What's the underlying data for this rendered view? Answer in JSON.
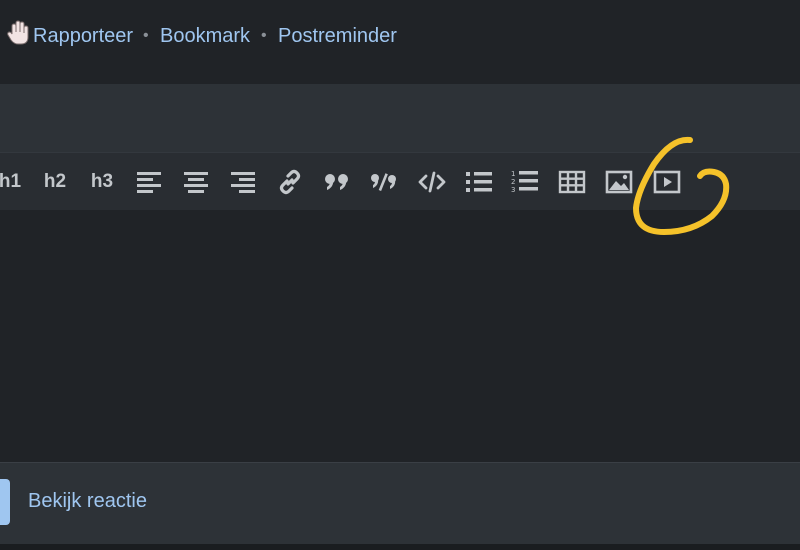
{
  "post_actions": {
    "report_label": "Rapporteer",
    "bookmark_label": "Bookmark",
    "reminder_label": "Postreminder",
    "separator": "•",
    "report_icon": "hand-icon"
  },
  "toolbar": {
    "h1_label": "h1",
    "h2_label": "h2",
    "h3_label": "h3",
    "buttons": [
      "align-left-icon",
      "align-center-icon",
      "align-right-icon",
      "link-icon",
      "quote-icon",
      "spoiler-icon",
      "code-icon",
      "bulleted-list-icon",
      "numbered-list-icon",
      "table-icon",
      "image-icon",
      "video-icon"
    ]
  },
  "footer": {
    "view_reply_label": "Bekijk reactie"
  },
  "colors": {
    "link": "#9fc6f0",
    "icon": "#c3c7cb",
    "background": "#202327",
    "panel": "#2d3237",
    "annotation": "#f5c22a"
  }
}
